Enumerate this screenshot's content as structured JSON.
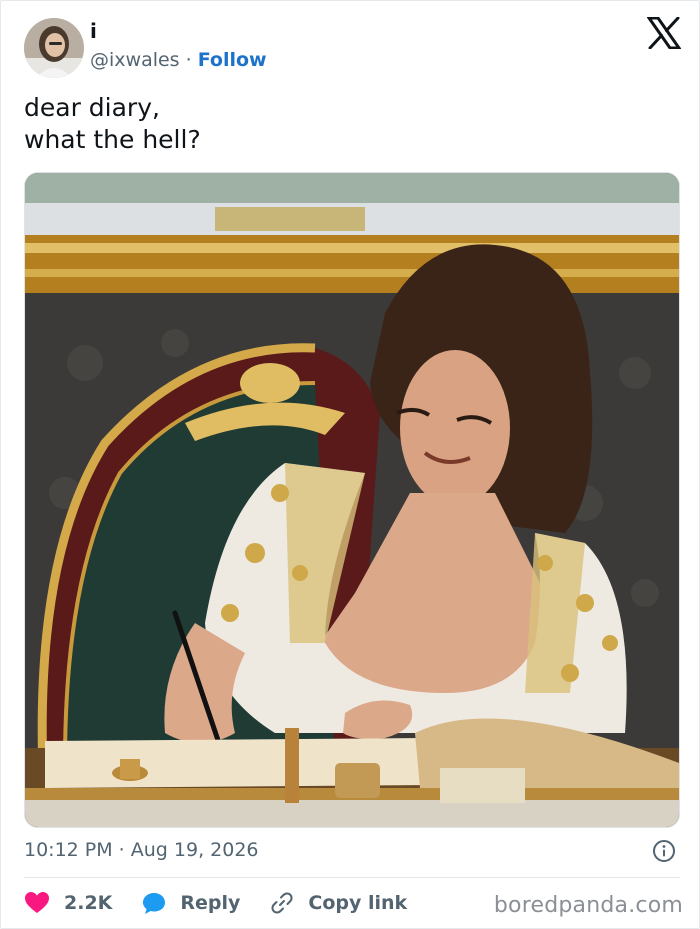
{
  "author": {
    "display_name": "i",
    "handle": "@ixwales",
    "separator": " · ",
    "follow_label": "Follow",
    "avatar_icon": "avatar-photo"
  },
  "tweet": {
    "line1": "dear diary,",
    "line2": "what the hell?",
    "image_icon": "photo-woman-signing-guestbook"
  },
  "meta": {
    "timestamp": "10:12 PM · Aug 19, 2026",
    "info_icon": "info-icon"
  },
  "actions": {
    "likes": "2.2K",
    "reply_label": "Reply",
    "copy_label": "Copy link"
  },
  "colors": {
    "accent": "#1d73c9",
    "like": "#f91880",
    "reply": "#1d9bf0",
    "muted": "#536471"
  },
  "watermark": "boredpanda.com"
}
